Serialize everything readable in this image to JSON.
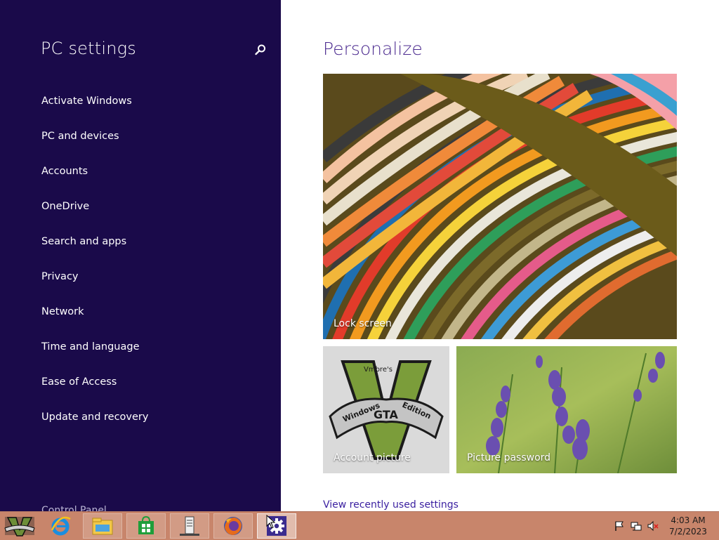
{
  "app": {
    "title": "PC settings"
  },
  "sidebar": {
    "search_icon": "search-icon",
    "items": [
      {
        "label": "Activate Windows"
      },
      {
        "label": "PC and devices"
      },
      {
        "label": "Accounts"
      },
      {
        "label": "OneDrive"
      },
      {
        "label": "Search and apps"
      },
      {
        "label": "Privacy"
      },
      {
        "label": "Network"
      },
      {
        "label": "Time and language"
      },
      {
        "label": "Ease of Access"
      },
      {
        "label": "Update and recovery"
      }
    ],
    "control_panel": "Control Panel"
  },
  "main": {
    "title": "Personalize",
    "tiles": {
      "lock_screen": "Lock screen",
      "account_picture": "Account picture",
      "picture_password": "Picture password"
    },
    "account_picture_text": {
      "top": "Vmbre's",
      "left": "Windows",
      "center": "GTA",
      "right": "Edition"
    },
    "recent_link": "View recently used settings"
  },
  "taskbar": {
    "apps": [
      {
        "name": "gta-v-icon"
      },
      {
        "name": "internet-explorer-icon"
      },
      {
        "name": "file-explorer-icon"
      },
      {
        "name": "store-icon"
      },
      {
        "name": "server-manager-icon"
      },
      {
        "name": "firefox-icon"
      },
      {
        "name": "pc-settings-gear-icon",
        "active": true
      }
    ],
    "tray": [
      "action-center-flag-icon",
      "network-icon",
      "volume-muted-icon"
    ],
    "clock": {
      "time": "4:03 AM",
      "date": "7/2/2023"
    }
  },
  "colors": {
    "sidebar_bg": "#1a0a4a",
    "accent": "#4b2a8f",
    "link": "#3a1fa0",
    "taskbar_bg": "#c8856b"
  }
}
